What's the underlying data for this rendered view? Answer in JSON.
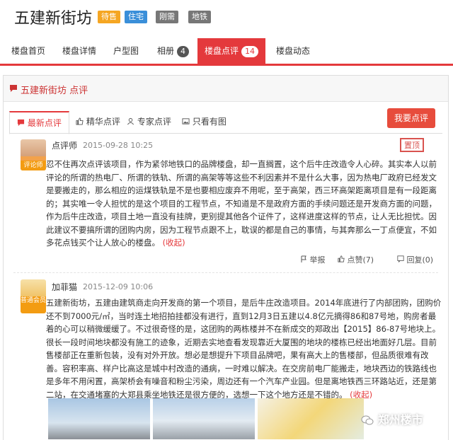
{
  "header": {
    "title": "五建新街坊",
    "tags": [
      {
        "label": "待售",
        "color": "#f5a623"
      },
      {
        "label": "住宅",
        "color": "#3a8fd9"
      },
      {
        "label": "刚需",
        "color": "#777777"
      },
      {
        "label": "地铁",
        "color": "#777777"
      }
    ]
  },
  "nav": {
    "tabs": [
      {
        "label": "楼盘首页"
      },
      {
        "label": "楼盘详情"
      },
      {
        "label": "户型图"
      },
      {
        "label": "相册",
        "badge": "4"
      },
      {
        "label": "楼盘点评",
        "badge": "14"
      },
      {
        "label": "楼盘动态"
      }
    ],
    "accent": "#e4393c"
  },
  "panel": {
    "title": "五建新街坊 点评",
    "subtabs": [
      "最新点评",
      "精华点评",
      "专家点评",
      "只看有图"
    ],
    "write_button": "我要点评"
  },
  "reviews": [
    {
      "user": "点评师",
      "avatar_label": "评论师",
      "date": "2015-09-28 10:25",
      "stamp": "置顶",
      "text": "忍不住再次点评该项目，作为紧邻地铁口的品牌楼盘，却一直搁置，这个后牛庄改造令人心碎。其实本人以前评论的所谓的热电厂、所谓的铁轨、所谓的高架等等这些不利因素并不是什么大事，因为热电厂政府已经发文是要搬走的，那么相应的运煤铁轨是不是也要相应废弃不用呢，至于高架，西三环高架距离项目是有一段距离的；其实唯一令人担忧的是这个项目的工程节点，不知道是不是政府方面的手续问题还是开发商方面的问题，作为后牛庄改造，项目土地一直没有挂牌，更别提其他各个证件了，这样进度这样的节点，让人无比担忧。因此建议不要搞所谓的团购内房，因为工程节点跟不上，耽误的都是自己的事情，与其奔那么一丁点便宜，不如多花点钱买个让人放心的楼盘。",
      "fold": "(收起)",
      "actions": {
        "report": "举报",
        "like": "点赞(7)",
        "reply": "回复(0)"
      }
    },
    {
      "user": "加菲猫",
      "avatar_label": "普通会员",
      "date": "2015-12-09 10:06",
      "text": "五建新街坊，五建由建筑商走向开发商的第一个项目，是后牛庄改造项目。2014年底进行了内部团购，团购价还不到7000元/㎡，当时连土地招拍挂都没有进行，直到12月3日五建以4.8亿元摘得86和87号地，购房者最着的心可以稍微缓缓了。不过很奇怪的是，这团购的两栋楼并不在新成交的郑政出【2015】86-87号地块上。很长一段时间地块都没有施工的迹象，近期去实地查看发现靠近大厦围的地块的楼栋已经出地面好几层。目前售楼部正在重新包装，没有对外开放。想必是想提升下项目品牌吧，果有高大上的售楼部，但品质很难有改善。容积率高、样户比高这是城中村改造的通病，一时难以解决。在交房前电厂能搬走，地块西边的铁路线也是多年不用闲置，高架桥会有噪音和粉尘污染，周边还有一个汽车产业园。但是离地铁西三环路站近，还是第二站，在交通堵塞的大郑县乘坐地铁还是很方便的，选想一下这个地方还是不错的。",
      "fold": "(收起)"
    }
  ],
  "watermark": "郑州楼市"
}
